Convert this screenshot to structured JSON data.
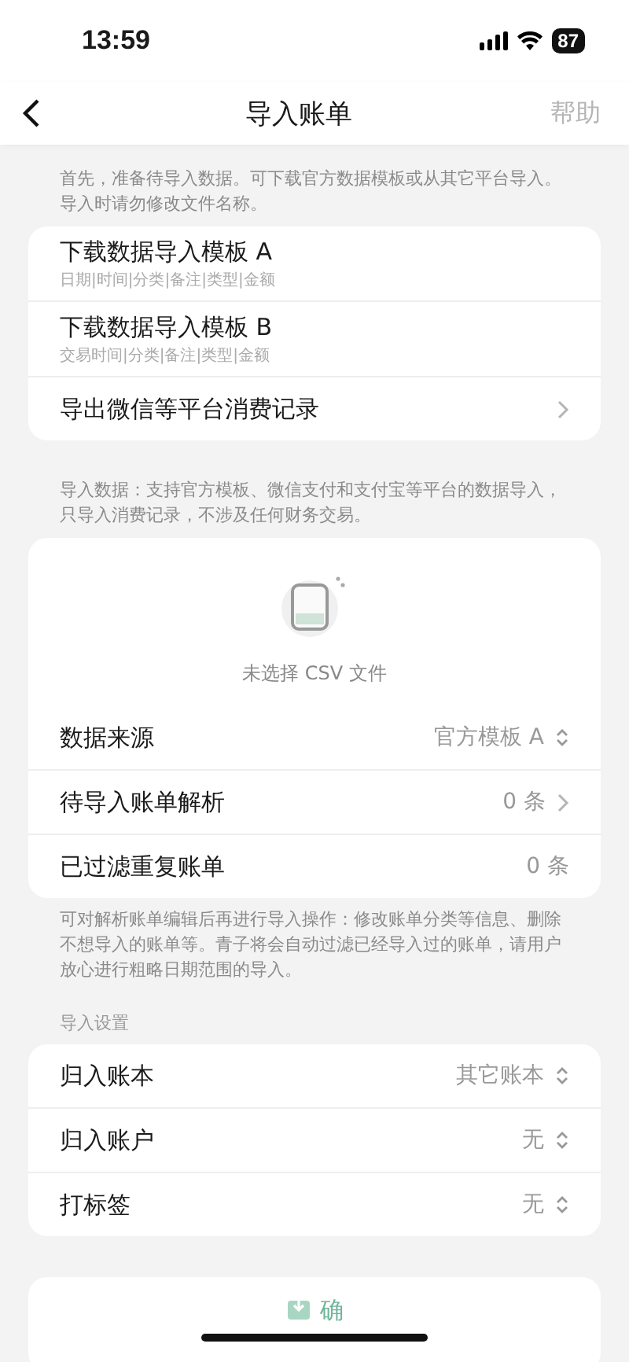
{
  "status_bar": {
    "time": "13:59",
    "battery": "87"
  },
  "nav": {
    "title": "导入账单",
    "action": "帮助"
  },
  "intro": "首先，准备待导入数据。可下载官方数据模板或从其它平台导入。导入时请勿修改文件名称。",
  "templates": [
    {
      "title": "下载数据导入模板 A",
      "subtitle": "日期|时间|分类|备注|类型|金额",
      "kind": "download"
    },
    {
      "title": "下载数据导入模板 B",
      "subtitle": "交易时间|分类|备注|类型|金额",
      "kind": "download"
    },
    {
      "title": "导出微信等平台消费记录",
      "kind": "link"
    }
  ],
  "import_note": "导入数据：支持官方模板、微信支付和支付宝等平台的数据导入，只导入消费记录，不涉及任何财务交易。",
  "file_picker": {
    "label": "未选择 CSV 文件"
  },
  "import_rows": [
    {
      "label": "数据来源",
      "value": "官方模板 A",
      "kind": "select"
    },
    {
      "label": "待导入账单解析",
      "value": "0 条",
      "kind": "link"
    },
    {
      "label": "已过滤重复账单",
      "value": "0 条",
      "kind": "plain"
    }
  ],
  "edit_note": "可对解析账单编辑后再进行导入操作：修改账单分类等信息、删除不想导入的账单等。青子将会自动过滤已经导入过的账单，请用户放心进行粗略日期范围的导入。",
  "settings": {
    "heading": "导入设置",
    "rows": [
      {
        "label": "归入账本",
        "value": "其它账本",
        "kind": "select"
      },
      {
        "label": "归入账户",
        "value": "无",
        "kind": "select"
      },
      {
        "label": "打标签",
        "value": "无",
        "kind": "select"
      }
    ]
  },
  "confirm_button": {
    "label": "确"
  }
}
